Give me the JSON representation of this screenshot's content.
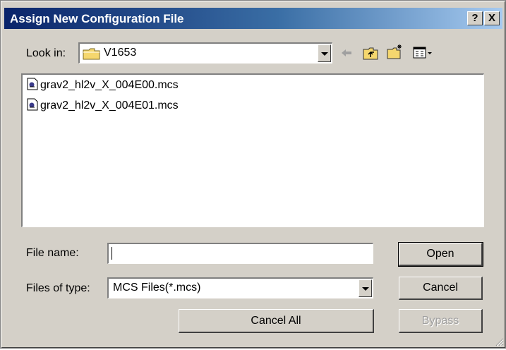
{
  "window": {
    "title": "Assign New Configuration File",
    "help_button": "?",
    "close_button": "X"
  },
  "lookin": {
    "label": "Look in:",
    "value": "V1653",
    "icons": [
      "folder-icon",
      "back-arrow-icon",
      "up-folder-icon",
      "new-folder-icon",
      "view-menu-icon"
    ]
  },
  "files": [
    {
      "name": "grav2_hl2v_X_004E00.mcs",
      "icon": "file-icon"
    },
    {
      "name": "grav2_hl2v_X_004E01.mcs",
      "icon": "file-icon"
    }
  ],
  "filename": {
    "label": "File name:",
    "value": ""
  },
  "filetype": {
    "label": "Files of type:",
    "value": "MCS Files(*.mcs)"
  },
  "buttons": {
    "open": "Open",
    "cancel": "Cancel",
    "cancel_all": "Cancel All",
    "bypass": "Bypass"
  }
}
